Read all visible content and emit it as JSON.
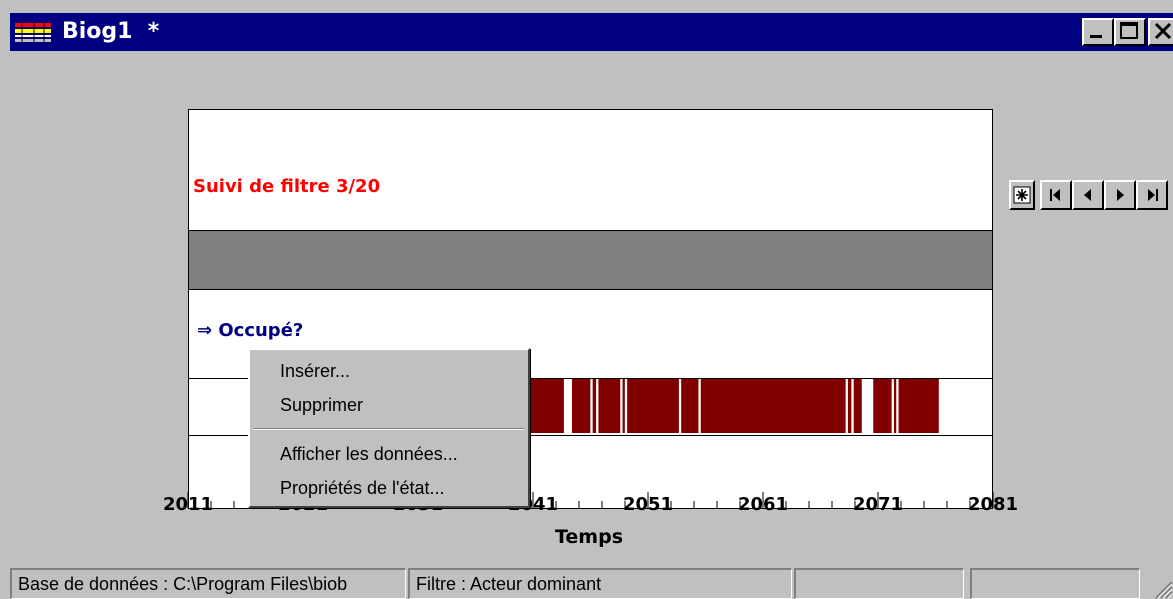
{
  "window": {
    "title": "Biog1  *",
    "controls": [
      "minimize",
      "maximize",
      "close"
    ]
  },
  "chart": {
    "filter_title": "Suivi de filtre 3/20",
    "question": "⇒  Occupé?",
    "axis_title": "Temps",
    "tick_labels": [
      "2011",
      "2021",
      "2031",
      "2041",
      "2051",
      "2061",
      "2071",
      "2081"
    ],
    "colors": {
      "state": "#800000",
      "band": "#808080",
      "title": "#ff0000",
      "question": "#000080"
    }
  },
  "chart_data": {
    "type": "timeline",
    "xlabel": "Temps",
    "xlim": [
      2011,
      2081
    ],
    "series": [
      {
        "label": "Occupé?",
        "occupied_intervals": [
          [
            2033.0,
            2043.6
          ],
          [
            2044.3,
            2045.9
          ],
          [
            2046.1,
            2046.4
          ],
          [
            2046.6,
            2048.5
          ],
          [
            2048.7,
            2048.9
          ],
          [
            2049.1,
            2053.6
          ],
          [
            2053.8,
            2055.3
          ],
          [
            2055.5,
            2068.1
          ],
          [
            2068.3,
            2068.6
          ],
          [
            2068.8,
            2069.5
          ],
          [
            2070.5,
            2072.1
          ],
          [
            2072.3,
            2072.5
          ],
          [
            2072.7,
            2076.2
          ]
        ]
      }
    ]
  },
  "navigator": {
    "buttons": [
      "refresh-icon",
      "first-icon",
      "prev-icon",
      "next-icon",
      "last-icon"
    ]
  },
  "context_menu": {
    "items": [
      "Insérer...",
      "Supprimer",
      "Afficher les données...",
      "Propriétés de l'état..."
    ]
  },
  "statusbar": {
    "database": "Base de données : C:\\Program Files\\biob",
    "filter": "Filtre : Acteur dominant",
    "panel3": "",
    "panel4": ""
  }
}
